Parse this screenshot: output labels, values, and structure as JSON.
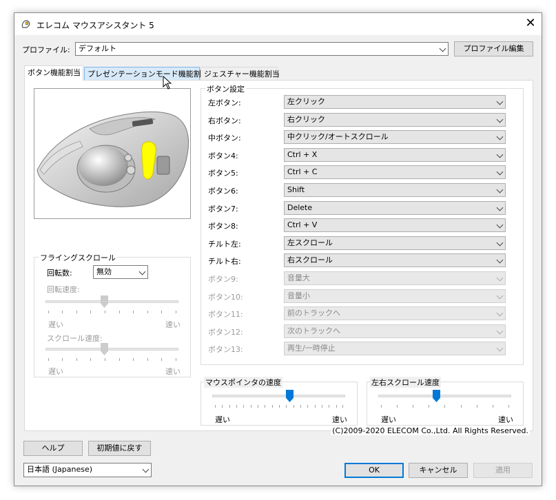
{
  "window": {
    "title": "エレコム マウスアシスタント 5"
  },
  "profile": {
    "label": "プロファイル:",
    "value": "デフォルト",
    "edit_button": "プロファイル編集"
  },
  "tabs": [
    {
      "label": "ボタン機能割当",
      "state": "active"
    },
    {
      "label": "プレゼンテーションモード機能割当",
      "state": "hover"
    },
    {
      "label": "ジェスチャー機能割当",
      "state": "normal"
    }
  ],
  "flying_scroll": {
    "title": "フライングスクロール",
    "rotation_label": "回転数:",
    "rotation_value": "無効",
    "rotation_speed_label": "回転速度:",
    "scroll_speed_label": "スクロール速度:",
    "slow": "遅い",
    "fast": "速い"
  },
  "button_settings": {
    "title": "ボタン設定",
    "rows": [
      {
        "label": "左ボタン:",
        "value": "左クリック",
        "enabled": true
      },
      {
        "label": "右ボタン:",
        "value": "右クリック",
        "enabled": true
      },
      {
        "label": "中ボタン:",
        "value": "中クリック/オートスクロール",
        "enabled": true
      },
      {
        "label": "ボタン4:",
        "value": "Ctrl + X",
        "enabled": true
      },
      {
        "label": "ボタン5:",
        "value": "Ctrl + C",
        "enabled": true
      },
      {
        "label": "ボタン6:",
        "value": "Shift",
        "enabled": true
      },
      {
        "label": "ボタン7:",
        "value": "Delete",
        "enabled": true
      },
      {
        "label": "ボタン8:",
        "value": "Ctrl + V",
        "enabled": true
      },
      {
        "label": "チルト左:",
        "value": "左スクロール",
        "enabled": true
      },
      {
        "label": "チルト右:",
        "value": "右スクロール",
        "enabled": true
      },
      {
        "label": "ボタン9:",
        "value": "音量大",
        "enabled": false
      },
      {
        "label": "ボタン10:",
        "value": "音量小",
        "enabled": false
      },
      {
        "label": "ボタン11:",
        "value": "前のトラックへ",
        "enabled": false
      },
      {
        "label": "ボタン12:",
        "value": "次のトラックへ",
        "enabled": false
      },
      {
        "label": "ボタン13:",
        "value": "再生/一時停止",
        "enabled": false
      }
    ]
  },
  "pointer_speed": {
    "title": "マウスポインタの速度",
    "slow": "遅い",
    "fast": "速い",
    "level": 0.58
  },
  "hscroll_speed": {
    "title": "左右スクロール速度",
    "slow": "遅い",
    "fast": "速い",
    "level": 0.43
  },
  "copyright": "(C)2009-2020 ELECOM Co.,Ltd. All Rights Reserved.",
  "footer": {
    "help": "ヘルプ",
    "reset": "初期値に戻す",
    "language": "日本語 (Japanese)",
    "ok": "OK",
    "cancel": "キャンセル",
    "apply": "適用"
  },
  "colors": {
    "accent": "#0078d7",
    "highlight": "#ffff00"
  }
}
